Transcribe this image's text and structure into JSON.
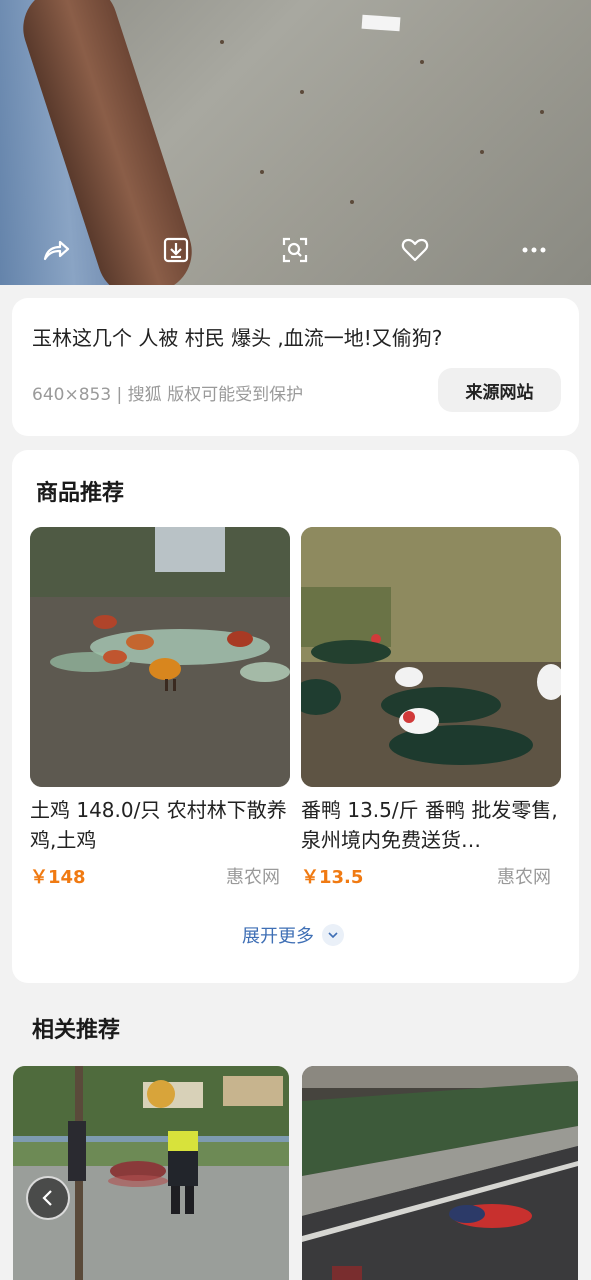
{
  "viewer": {
    "actions": [
      {
        "name": "share-icon",
        "label": "share"
      },
      {
        "name": "download-icon",
        "label": "download"
      },
      {
        "name": "image-search-icon",
        "label": "image search"
      },
      {
        "name": "heart-icon",
        "label": "favorite"
      },
      {
        "name": "more-icon",
        "label": "more"
      }
    ]
  },
  "info": {
    "title": "玉林这几个 人被 村民 爆头 ,血流一地!又偷狗?",
    "meta": "640×853 | 搜狐 版权可能受到保护",
    "source_button": "来源网站"
  },
  "products": {
    "section_title": "商品推荐",
    "items": [
      {
        "name": "土鸡 148.0/只  农村林下散养鸡,土鸡",
        "price": "￥148",
        "merchant": "惠农网"
      },
      {
        "name": "番鸭 13.5/斤 番鸭  批发零售,泉州境内免费送货…",
        "price": "￥13.5",
        "merchant": "惠农网"
      }
    ],
    "expand_label": "展开更多"
  },
  "related": {
    "section_title": "相关推荐"
  },
  "colors": {
    "accent_price": "#f07a12",
    "link_blue": "#3f6fb5",
    "background": "#f2f2f2"
  }
}
